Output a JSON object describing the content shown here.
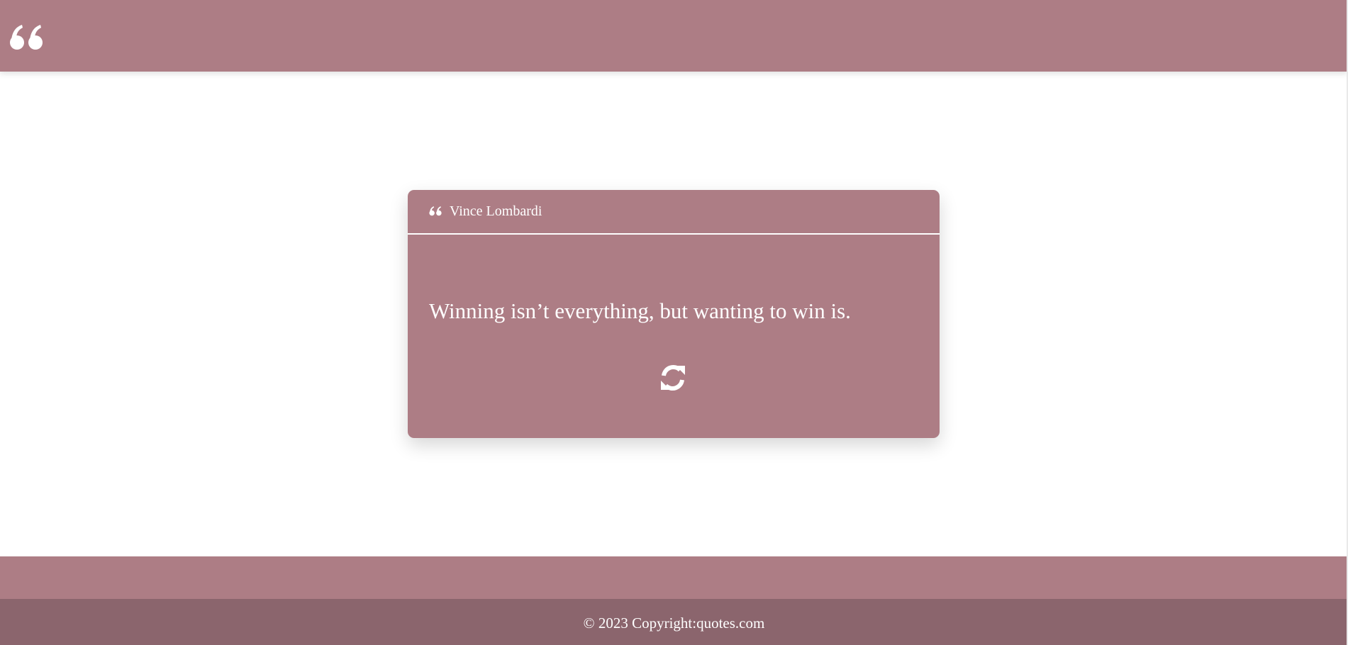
{
  "colors": {
    "primary": "#ad7d85",
    "footer_dark": "#8b656d",
    "text": "#ffffff",
    "background": "#ffffff"
  },
  "navbar": {
    "brand_icon": "quote-left-icon"
  },
  "quote_card": {
    "header_icon": "quote-left-icon",
    "author": "Vince Lombardi",
    "text": "Winning isn’t everything, but wanting to win is.",
    "refresh_icon": "refresh-icon"
  },
  "footer": {
    "copyright": "© 2023 Copyright:quotes.com"
  }
}
